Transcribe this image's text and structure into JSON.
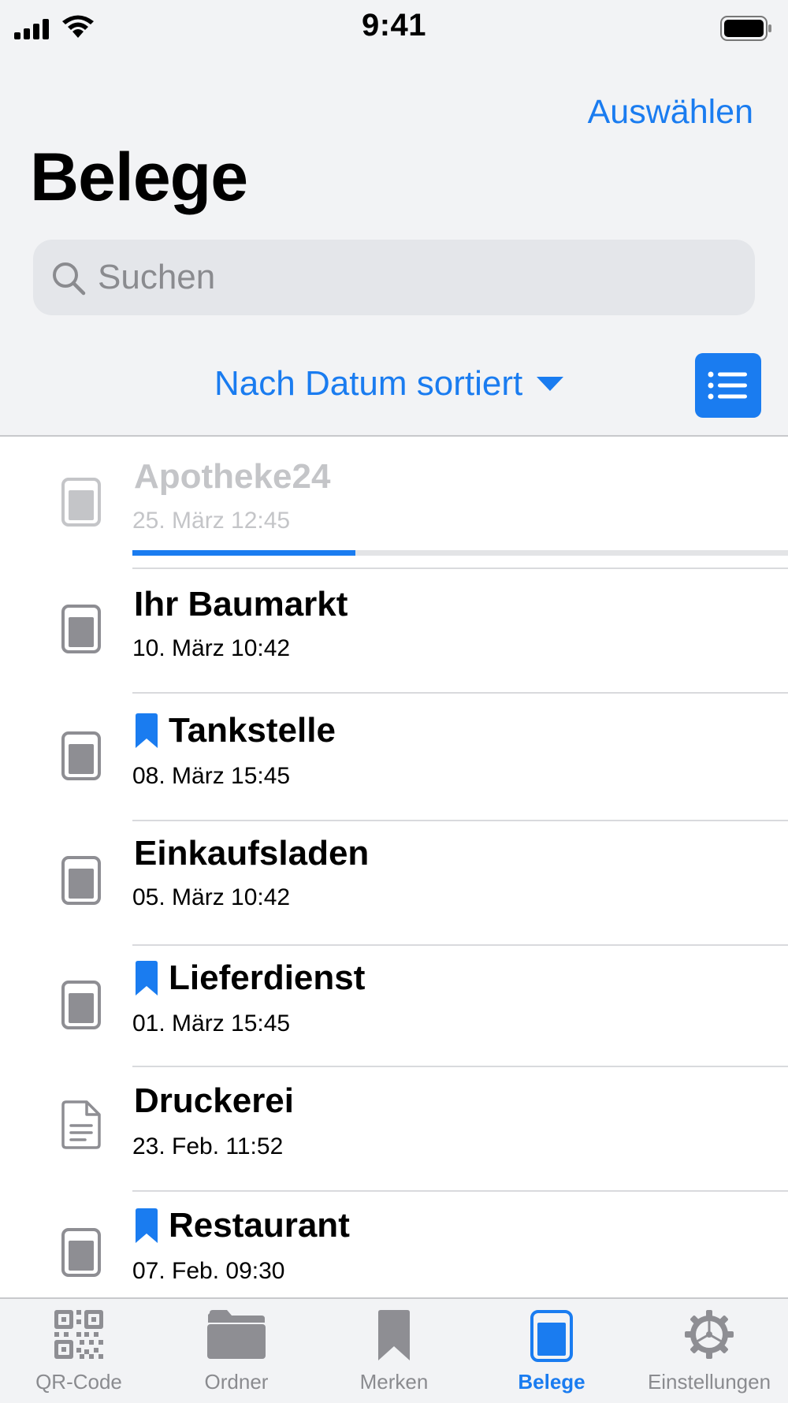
{
  "status_bar": {
    "time": "9:41"
  },
  "header": {
    "select_label": "Auswählen",
    "title": "Belege"
  },
  "search": {
    "placeholder": "Suchen"
  },
  "sort": {
    "label": "Nach Datum sortiert"
  },
  "colors": {
    "accent": "#1a7cf0",
    "bookmark": "#1a7cf0",
    "icon_gray": "#8e8e93"
  },
  "receipts": [
    {
      "title": "Apotheke24",
      "date": "25. März 12:45",
      "bookmarked": false,
      "icon": "receipt-icon",
      "uploading": true,
      "progress": 0.34
    },
    {
      "title": "Ihr Baumarkt",
      "date": "10. März 10:42",
      "bookmarked": false,
      "icon": "receipt-icon"
    },
    {
      "title": "Tankstelle",
      "date": "08. März 15:45",
      "bookmarked": true,
      "icon": "receipt-icon"
    },
    {
      "title": "Einkaufsladen",
      "date": "05. März 10:42",
      "bookmarked": false,
      "icon": "receipt-icon"
    },
    {
      "title": "Lieferdienst",
      "date": "01. März 15:45",
      "bookmarked": true,
      "icon": "receipt-icon"
    },
    {
      "title": "Druckerei",
      "date": "23. Feb. 11:52",
      "bookmarked": false,
      "icon": "document-icon"
    },
    {
      "title": "Restaurant",
      "date": "07. Feb. 09:30",
      "bookmarked": true,
      "icon": "receipt-icon"
    }
  ],
  "tabbar": {
    "active": "Belege",
    "items": [
      {
        "label": "QR-Code",
        "icon": "qr-code-icon"
      },
      {
        "label": "Ordner",
        "icon": "folder-icon"
      },
      {
        "label": "Merken",
        "icon": "bookmark-icon"
      },
      {
        "label": "Belege",
        "icon": "receipt-icon"
      },
      {
        "label": "Einstellungen",
        "icon": "gear-icon"
      }
    ]
  }
}
